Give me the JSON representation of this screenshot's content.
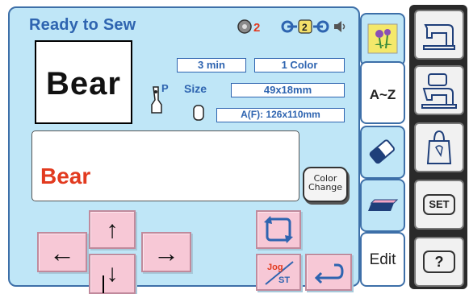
{
  "status": {
    "title": "Ready to Sew"
  },
  "indicators": {
    "thread_number": "2",
    "bobbin_number": "2"
  },
  "preview": {
    "text": "Bear"
  },
  "info": {
    "time": "3 min",
    "colors": "1 Color",
    "presser_foot": "P",
    "size_label": "Size",
    "size": "49x18mm",
    "area": "A(F): 126x110mm"
  },
  "text_input": {
    "value": "Bear"
  },
  "buttons": {
    "color_change": "Color Change",
    "jog": "Jog",
    "st": "ST",
    "set": "SET",
    "help": "?"
  },
  "tabs": {
    "font": "A~Z",
    "edit": "Edit"
  },
  "colors": {
    "panel_bg": "#bfe6f7",
    "accent_blue": "#2e64b0",
    "text_red": "#e23a1f",
    "button_pink": "#f7c8d6"
  }
}
